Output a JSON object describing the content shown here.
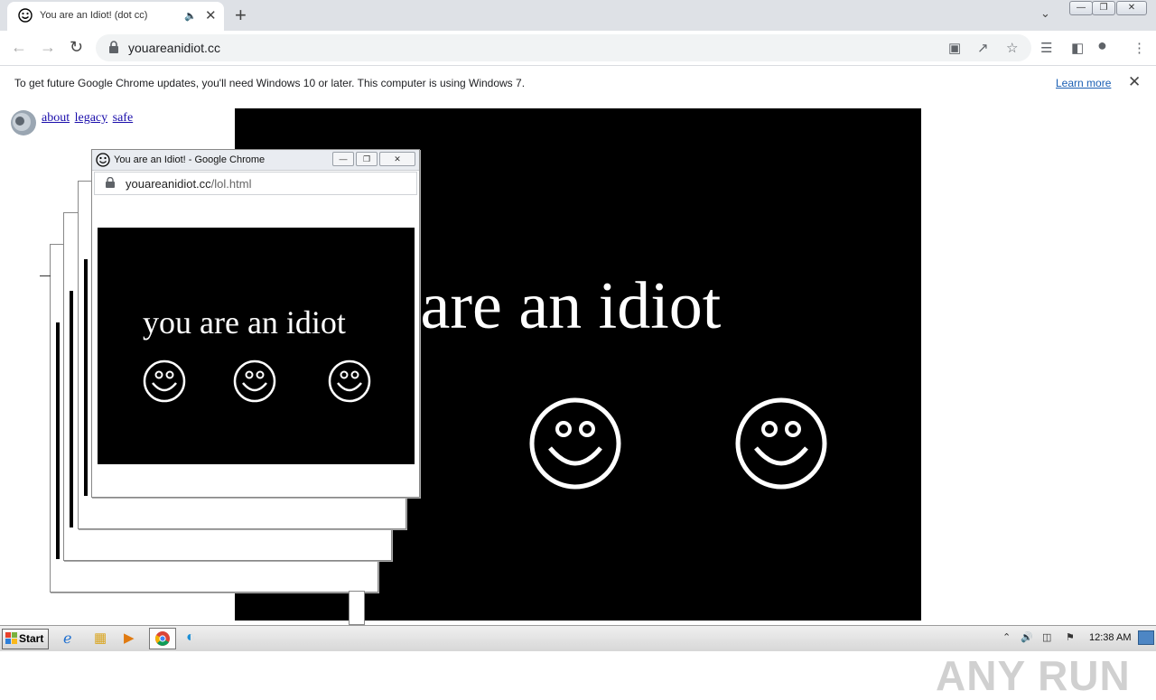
{
  "browser": {
    "tab_title": "You are an Idiot! (dot cc)",
    "tab_audio_icon": "speaker-icon",
    "url": "youareanidiot.cc",
    "infobar": {
      "message": "To get future Google Chrome updates, you'll need Windows 10 or later. This computer is using Windows 7.",
      "learn_more": "Learn more"
    }
  },
  "page": {
    "links": [
      "about",
      "legacy",
      "safe"
    ],
    "big_text": "u are an idiot",
    "popup_text": "you are an idiot"
  },
  "popup_window": {
    "title": "You are an Idiot! - Google Chrome",
    "url_host": "youareanidiot.cc",
    "url_path": "/lol.html"
  },
  "watermark": "ANY RUN",
  "taskbar": {
    "start_label": "Start",
    "clock": "12:38 AM"
  },
  "colors": {
    "accent_link": "#1a0dab",
    "panel_bg": "#000000",
    "panel_text": "#ffffff"
  }
}
